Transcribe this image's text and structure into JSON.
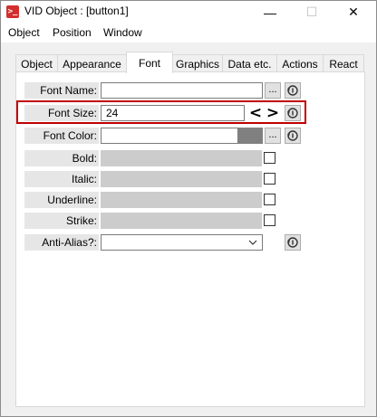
{
  "window": {
    "title": "VID Object : [button1]",
    "app_icon_glyph": ">_",
    "minimize_glyph": "—",
    "maximize_glyph": "☐",
    "close_glyph": "✕"
  },
  "menu": {
    "items": [
      "Object",
      "Position",
      "Window"
    ]
  },
  "tabs": {
    "items": [
      "Object",
      "Appearance",
      "Font",
      "Graphics",
      "Data etc.",
      "Actions",
      "React"
    ],
    "active": "Font"
  },
  "font_panel": {
    "font_name": {
      "label": "Font Name:",
      "value": "",
      "browse_label": "..."
    },
    "font_size": {
      "label": "Font Size:",
      "value": "24",
      "decrease_label": "<",
      "increase_label": ">"
    },
    "font_color": {
      "label": "Font Color:",
      "value": "",
      "swatch_color": "#808080",
      "browse_label": "..."
    },
    "bold": {
      "label": "Bold:",
      "checked": false
    },
    "italic": {
      "label": "Italic:",
      "checked": false
    },
    "underline": {
      "label": "Underline:",
      "checked": false
    },
    "strike": {
      "label": "Strike:",
      "checked": false
    },
    "anti_alias": {
      "label": "Anti-Alias?:",
      "value": ""
    }
  },
  "colors": {
    "highlight": "#c00000",
    "label_bg": "#e6e6e6",
    "disabled_field": "#cccccc"
  }
}
